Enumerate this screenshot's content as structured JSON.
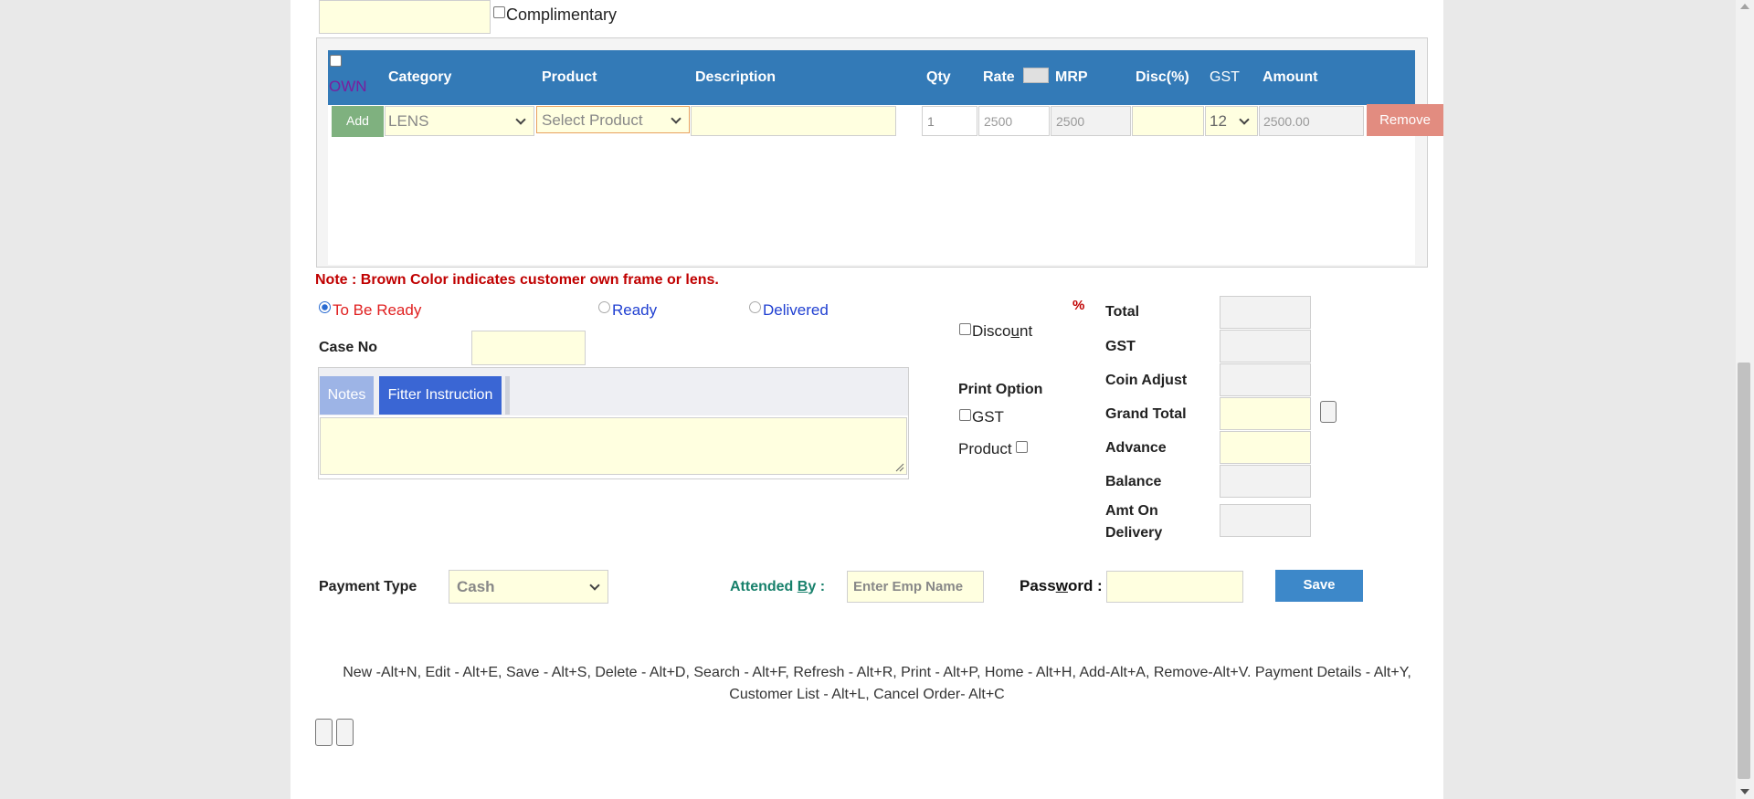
{
  "top": {
    "complimentary_label": "Complimentary"
  },
  "grid": {
    "own_label": "OWN",
    "headers": {
      "category": "Category",
      "product": "Product",
      "description": "Description",
      "qty": "Qty",
      "rate": "Rate",
      "mrp": "MRP",
      "disc": "Disc(%)",
      "gst": "GST",
      "amount": "Amount"
    },
    "row": {
      "add_label": "Add",
      "category": "LENS",
      "product": "Select Product",
      "qty": "1",
      "rate": "2500",
      "mrp": "2500",
      "gst": "12",
      "amount": "2500.00",
      "remove_label": "Remove"
    }
  },
  "note": "Note : Brown Color indicates customer own frame or lens.",
  "status": {
    "to_be_ready": "To Be Ready",
    "ready": "Ready",
    "delivered": "Delivered"
  },
  "case_no_label": "Case No",
  "tabs": {
    "notes": "Notes",
    "filter": "Fitter Instruction"
  },
  "discount": {
    "percent_sign": "%",
    "label_pre": "Disco",
    "label_ul": "u",
    "label_post": "nt"
  },
  "print_option": {
    "label": "Print Option",
    "gst": "GST",
    "product": "Product"
  },
  "totals": {
    "total": "Total",
    "gst": "GST",
    "coin": "Coin Adjust",
    "grand": "Grand Total",
    "advance": "Advance",
    "balance": "Balance",
    "amt_on_delivery": "Amt On Delivery"
  },
  "payment": {
    "label": "Payment Type",
    "value": "Cash"
  },
  "attended": {
    "label_pre": "Attended ",
    "label_ul": "B",
    "label_post": "y :",
    "placeholder": "Enter Emp Name"
  },
  "password": {
    "label_pre": "Pass",
    "label_ul": "w",
    "label_post": "ord :"
  },
  "save_label": "Save",
  "shortcuts": {
    "line1": "New -Alt+N, Edit - Alt+E, Save - Alt+S, Delete - Alt+D, Search - Alt+F, Refresh - Alt+R, Print - Alt+P, Home - Alt+H, Add-Alt+A, Remove-Alt+V. Payment Details - Alt+Y,",
    "line2": "Customer List - Alt+L, Cancel Order- Alt+C"
  },
  "colors": {
    "header_blue": "#337ab7",
    "input_yellow": "#ffffe0",
    "add_green": "#7fb17f",
    "remove_red": "#e28c80",
    "note_red": "#c00000"
  }
}
